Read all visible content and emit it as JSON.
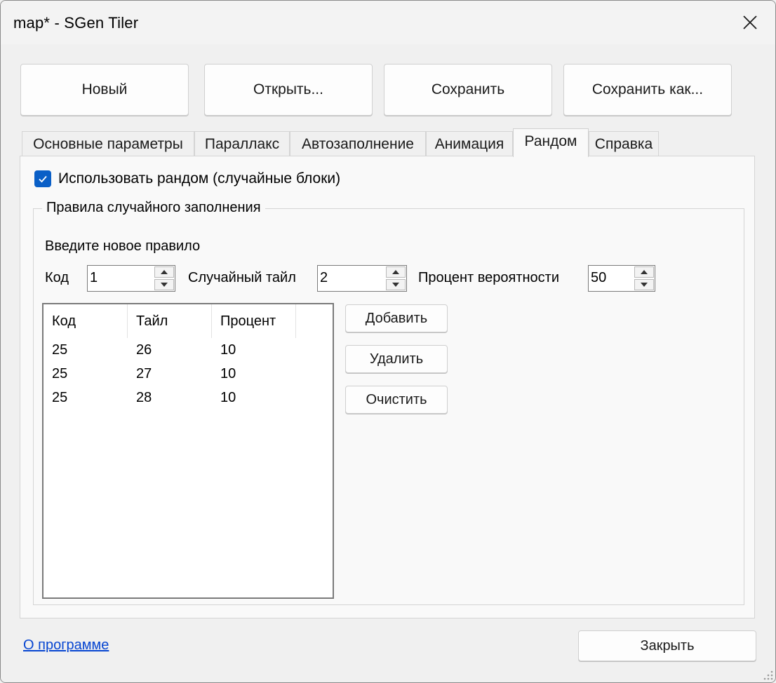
{
  "window": {
    "title": "map* - SGen Tiler"
  },
  "toolbar": {
    "new_label": "Новый",
    "open_label": "Открыть...",
    "save_label": "Сохранить",
    "save_as_label": "Сохранить как..."
  },
  "tabs": [
    {
      "label": "Основные параметры",
      "active": false
    },
    {
      "label": "Параллакс",
      "active": false
    },
    {
      "label": "Автозаполнение",
      "active": false
    },
    {
      "label": "Анимация",
      "active": false
    },
    {
      "label": "Рандом",
      "active": true
    },
    {
      "label": "Справка",
      "active": false
    }
  ],
  "random": {
    "use_random_label": "Использовать рандом (случайные блоки)",
    "use_random_checked": true,
    "group_title": "Правила случайного заполнения",
    "new_rule_label": "Введите новое правило",
    "code_label": "Код",
    "code_value": "1",
    "tile_label": "Случайный тайл",
    "tile_value": "2",
    "percent_label": "Процент вероятности",
    "percent_value": "50",
    "table": {
      "columns": [
        "Код",
        "Тайл",
        "Процент"
      ],
      "rows": [
        [
          "25",
          "26",
          "10"
        ],
        [
          "25",
          "27",
          "10"
        ],
        [
          "25",
          "28",
          "10"
        ]
      ]
    },
    "add_label": "Добавить",
    "delete_label": "Удалить",
    "clear_label": "Очистить"
  },
  "footer": {
    "about_label": "О программе",
    "close_label": "Закрыть"
  },
  "colors": {
    "accent": "#0a5fc7",
    "link": "#0645d1"
  },
  "icons": {
    "close": "close-icon",
    "check": "check-icon",
    "spin_up": "up-arrow-icon",
    "spin_down": "down-arrow-icon"
  }
}
